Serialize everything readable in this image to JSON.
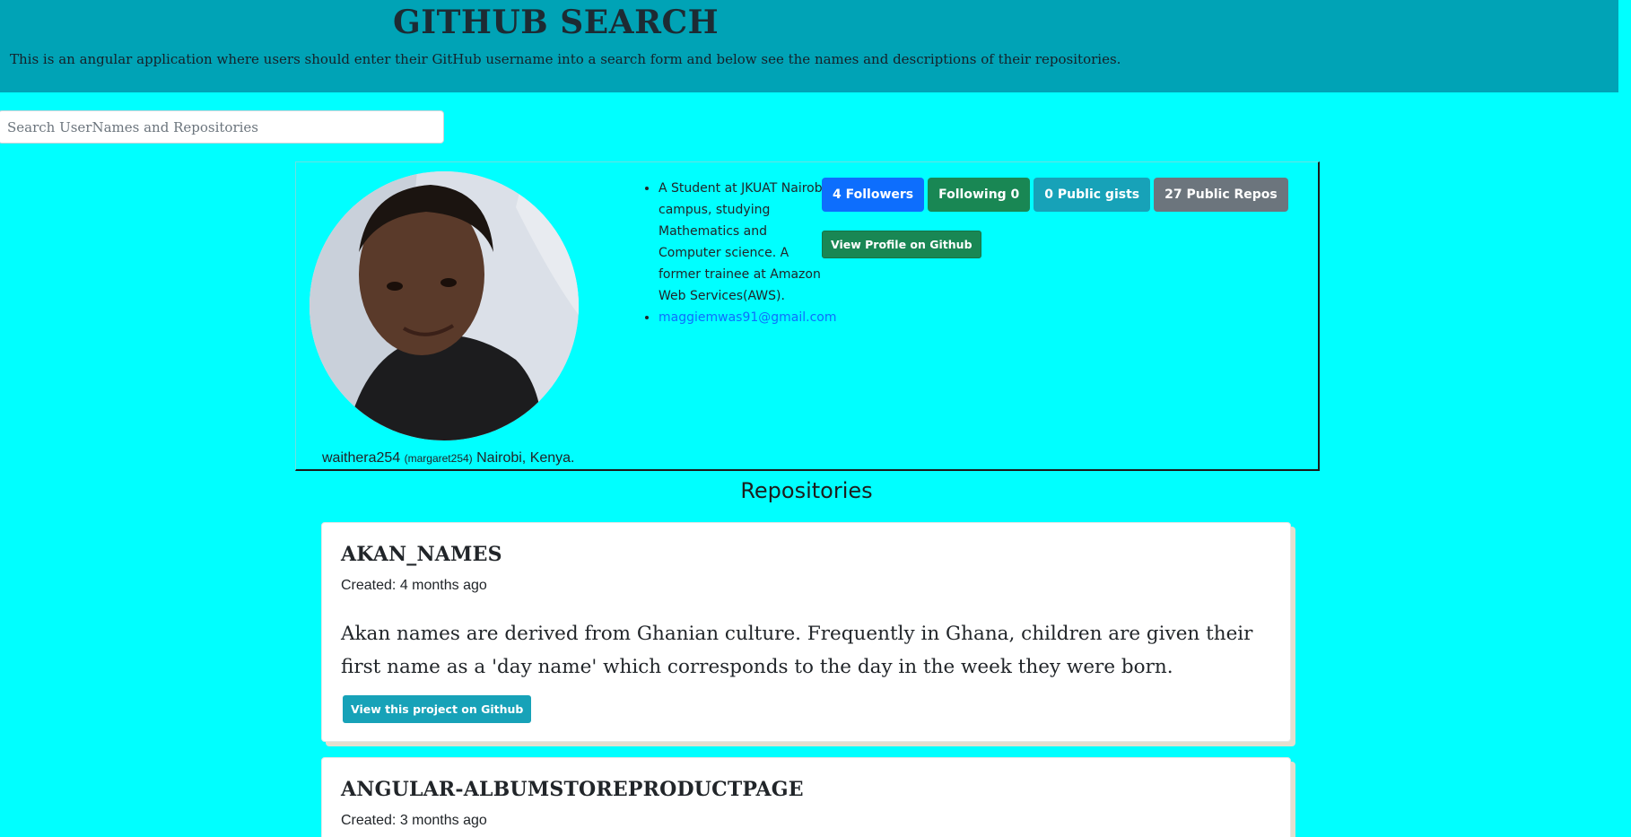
{
  "header": {
    "title": "GITHUB SEARCH",
    "description": "This is an angular application where users should enter their GitHub username into a search form and below see the names and descriptions of their repositories."
  },
  "search": {
    "placeholder": "Search UserNames and Repositories",
    "value": ""
  },
  "profile": {
    "name": "waithera254",
    "login": "(margaret254)",
    "location": "Nairobi, Kenya.",
    "bio": "A Student at JKUAT Nairobi campus, studying Mathematics and Computer science. A former trainee at Amazon Web Services(AWS).",
    "email": "maggiemwas91@gmail.com",
    "badges": {
      "followers": "4 Followers",
      "following": "Following 0",
      "gists": "0 Public gists",
      "repos": "27 Public Repos"
    },
    "view_profile_label": "View Profile on Github"
  },
  "repositories": {
    "title": "Repositories",
    "items": [
      {
        "name": "AKAN_NAMES",
        "created": "Created: 4 months ago",
        "description": "Akan names are derived from Ghanian culture. Frequently in Ghana, children are given their first name as a 'day name' which corresponds to the day in the week they were born.",
        "button_label": "View this project on Github"
      },
      {
        "name": "ANGULAR-ALBUMSTOREPRODUCTPAGE",
        "created": "Created: 3 months ago"
      }
    ]
  },
  "colors": {
    "page_bg": "#00ffff",
    "header_bg": "#00a3b6",
    "followers": "#0d6efd",
    "following": "#198754",
    "gists": "#17a2b8",
    "repos": "#6c757d"
  }
}
